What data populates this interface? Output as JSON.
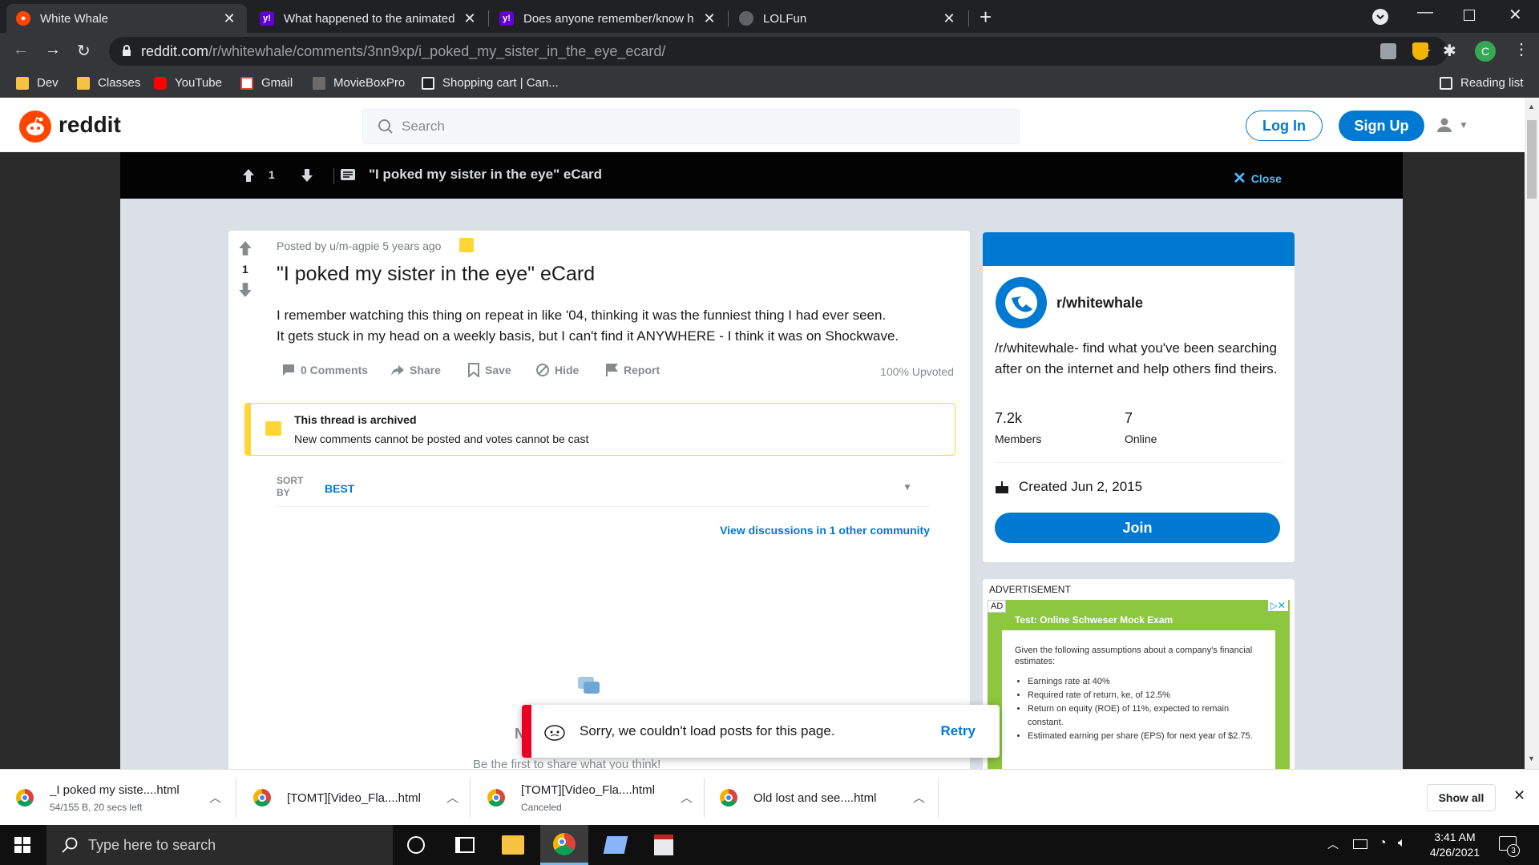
{
  "browser": {
    "tabs": [
      {
        "title": "White Whale",
        "active": true
      },
      {
        "title": "What happened to the animated",
        "active": false
      },
      {
        "title": "Does anyone remember/know h",
        "active": false
      },
      {
        "title": "LOLFun",
        "active": false
      }
    ],
    "url_host": "reddit.com",
    "url_path": "/r/whitewhale/comments/3nn9xp/i_poked_my_sister_in_the_eye_ecard/",
    "profile_initial": "C",
    "bookmarks": [
      "Dev",
      "Classes",
      "YouTube",
      "Gmail",
      "MovieBoxPro",
      "Shopping cart | Can..."
    ],
    "reading_list": "Reading list"
  },
  "reddit": {
    "logo_text": "reddit",
    "search_placeholder": "Search",
    "login": "Log In",
    "signup": "Sign Up"
  },
  "postbar": {
    "votes": "1",
    "title": "\"I poked my sister in the eye\" eCard",
    "close": "Close"
  },
  "post": {
    "meta": "Posted by u/m-agpie 5 years ago",
    "votes": "1",
    "title": "\"I poked my sister in the eye\" eCard",
    "body_line1": "I remember watching this thing on repeat in like '04, thinking it was the funniest thing I had ever seen.",
    "body_line2": "It gets stuck in my head on a weekly basis, but I can't find it ANYWHERE - I think it was on Shockwave.",
    "actions": {
      "comments": "0 Comments",
      "share": "Share",
      "save": "Save",
      "hide": "Hide",
      "report": "Report"
    },
    "upvoted": "100% Upvoted",
    "archived_title": "This thread is archived",
    "archived_text": "New comments cannot be posted and votes cannot be cast",
    "sort_label_1": "SORT",
    "sort_label_2": "BY",
    "sort_value": "BEST",
    "view_discussions": "View discussions in 1 other community",
    "empty_partial": "N",
    "first_share": "Be the first to share what you think!"
  },
  "toast": {
    "message": "Sorry, we couldn't load posts for this page.",
    "retry": "Retry"
  },
  "sidebar": {
    "community": "r/whitewhale",
    "description": "/r/whitewhale- find what you've been searching after on the internet and help others find theirs.",
    "members_value": "7.2k",
    "members_label": "Members",
    "online_value": "7",
    "online_label": "Online",
    "created": "Created Jun 2, 2015",
    "join": "Join",
    "accent_color": "#0079d3"
  },
  "ad": {
    "label": "ADVERTISEMENT",
    "badge": "AD",
    "headline": "Test: Online Schweser Mock Exam",
    "intro": "Given the following assumptions about a company's financial estimates:",
    "bullets": [
      "Earnings rate at 40%",
      "Required rate of return, ke, of 12.5%",
      "Return on equity (ROE) of 11%, expected to remain constant.",
      "Estimated earning per share (EPS) for next year of $2.75."
    ]
  },
  "downloads": [
    {
      "name": "_I poked my siste....html",
      "status": "54/155 B, 20 secs left"
    },
    {
      "name": "[TOMT][Video_Fla....html",
      "status": ""
    },
    {
      "name": "[TOMT][Video_Fla....html",
      "status": "Canceled"
    },
    {
      "name": "Old lost and see....html",
      "status": ""
    }
  ],
  "show_all": "Show all",
  "taskbar": {
    "search_placeholder": "Type here to search",
    "time": "3:41 AM",
    "date": "4/26/2021",
    "notifications": "3"
  }
}
